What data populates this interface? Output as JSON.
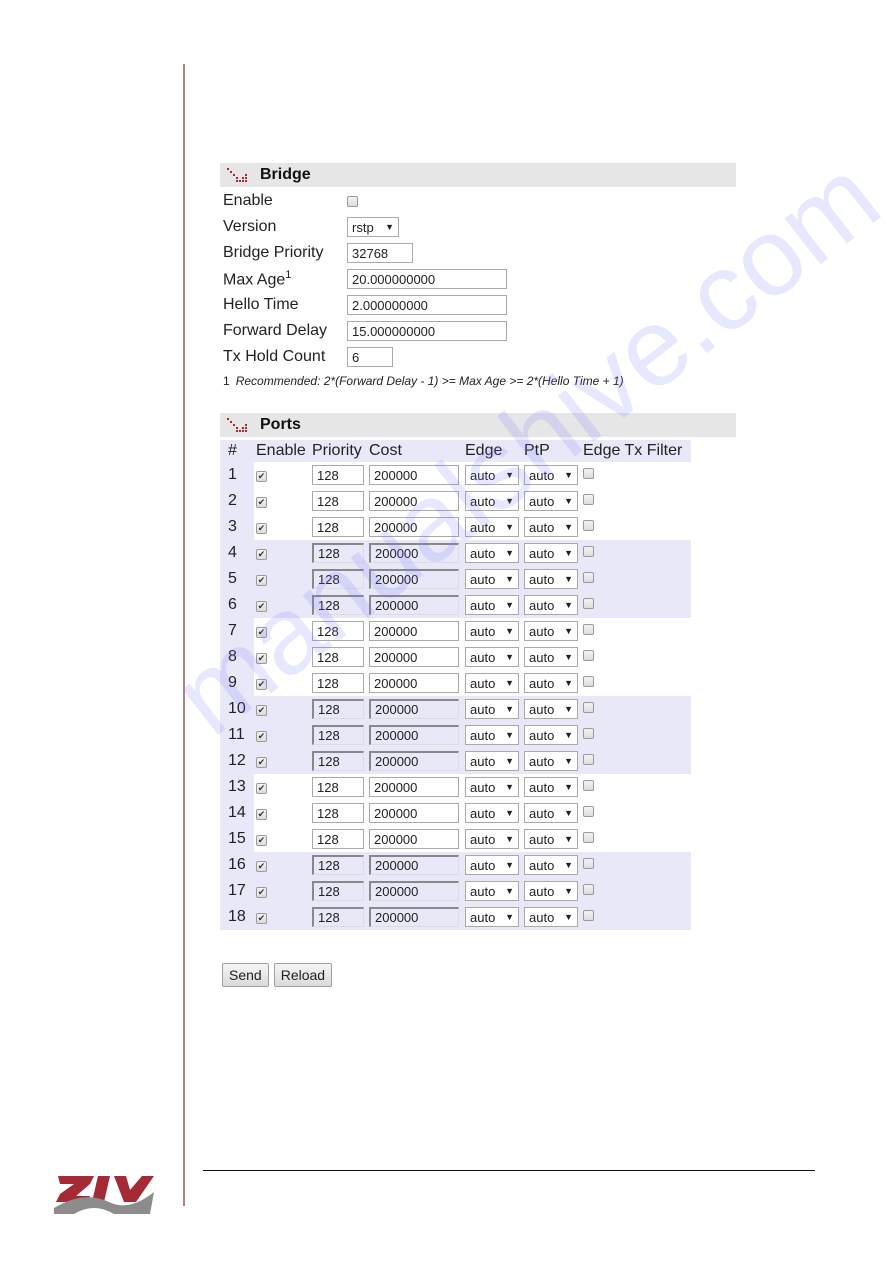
{
  "bridge": {
    "title": "Bridge",
    "icon": "dotted-arrow-icon",
    "fields": {
      "enable": {
        "label": "Enable",
        "checked": false
      },
      "version": {
        "label": "Version",
        "value": "rstp"
      },
      "bridge_priority": {
        "label": "Bridge Priority",
        "value": "32768"
      },
      "max_age": {
        "label": "Max Age",
        "sup": "1",
        "value": "20.000000000"
      },
      "hello_time": {
        "label": "Hello Time",
        "value": "2.000000000"
      },
      "forward_delay": {
        "label": "Forward Delay",
        "value": "15.000000000"
      },
      "tx_hold_count": {
        "label": "Tx Hold Count",
        "value": "6"
      }
    },
    "note_num": "1",
    "note_text": "Recommended: 2*(Forward Delay - 1) >= Max Age >= 2*(Hello Time + 1)"
  },
  "ports": {
    "title": "Ports",
    "icon": "dotted-arrow-icon",
    "columns": [
      "#",
      "Enable",
      "Priority",
      "Cost",
      "Edge",
      "PtP",
      "Edge Tx Filter"
    ],
    "rows": [
      {
        "num": "1",
        "enable": true,
        "priority": "128",
        "cost": "200000",
        "edge": "auto",
        "ptp": "auto",
        "edge_tx_filter": false
      },
      {
        "num": "2",
        "enable": true,
        "priority": "128",
        "cost": "200000",
        "edge": "auto",
        "ptp": "auto",
        "edge_tx_filter": false
      },
      {
        "num": "3",
        "enable": true,
        "priority": "128",
        "cost": "200000",
        "edge": "auto",
        "ptp": "auto",
        "edge_tx_filter": false
      },
      {
        "num": "4",
        "enable": true,
        "priority": "128",
        "cost": "200000",
        "edge": "auto",
        "ptp": "auto",
        "edge_tx_filter": false
      },
      {
        "num": "5",
        "enable": true,
        "priority": "128",
        "cost": "200000",
        "edge": "auto",
        "ptp": "auto",
        "edge_tx_filter": false
      },
      {
        "num": "6",
        "enable": true,
        "priority": "128",
        "cost": "200000",
        "edge": "auto",
        "ptp": "auto",
        "edge_tx_filter": false
      },
      {
        "num": "7",
        "enable": true,
        "priority": "128",
        "cost": "200000",
        "edge": "auto",
        "ptp": "auto",
        "edge_tx_filter": false
      },
      {
        "num": "8",
        "enable": true,
        "priority": "128",
        "cost": "200000",
        "edge": "auto",
        "ptp": "auto",
        "edge_tx_filter": false
      },
      {
        "num": "9",
        "enable": true,
        "priority": "128",
        "cost": "200000",
        "edge": "auto",
        "ptp": "auto",
        "edge_tx_filter": false
      },
      {
        "num": "10",
        "enable": true,
        "priority": "128",
        "cost": "200000",
        "edge": "auto",
        "ptp": "auto",
        "edge_tx_filter": false
      },
      {
        "num": "11",
        "enable": true,
        "priority": "128",
        "cost": "200000",
        "edge": "auto",
        "ptp": "auto",
        "edge_tx_filter": false
      },
      {
        "num": "12",
        "enable": true,
        "priority": "128",
        "cost": "200000",
        "edge": "auto",
        "ptp": "auto",
        "edge_tx_filter": false
      },
      {
        "num": "13",
        "enable": true,
        "priority": "128",
        "cost": "200000",
        "edge": "auto",
        "ptp": "auto",
        "edge_tx_filter": false
      },
      {
        "num": "14",
        "enable": true,
        "priority": "128",
        "cost": "200000",
        "edge": "auto",
        "ptp": "auto",
        "edge_tx_filter": false
      },
      {
        "num": "15",
        "enable": true,
        "priority": "128",
        "cost": "200000",
        "edge": "auto",
        "ptp": "auto",
        "edge_tx_filter": false
      },
      {
        "num": "16",
        "enable": true,
        "priority": "128",
        "cost": "200000",
        "edge": "auto",
        "ptp": "auto",
        "edge_tx_filter": false
      },
      {
        "num": "17",
        "enable": true,
        "priority": "128",
        "cost": "200000",
        "edge": "auto",
        "ptp": "auto",
        "edge_tx_filter": false
      },
      {
        "num": "18",
        "enable": true,
        "priority": "128",
        "cost": "200000",
        "edge": "auto",
        "ptp": "auto",
        "edge_tx_filter": false
      }
    ]
  },
  "buttons": {
    "send": "Send",
    "reload": "Reload"
  },
  "watermark": "manualshive.com",
  "logo": {
    "name": "ZIV",
    "colors": {
      "top": "#a52a36",
      "bottom": "#8c8c8c"
    }
  },
  "colors": {
    "accent": "#a52a36",
    "section_header": "#e6e6e6",
    "row_band": "#e8e8f8"
  }
}
